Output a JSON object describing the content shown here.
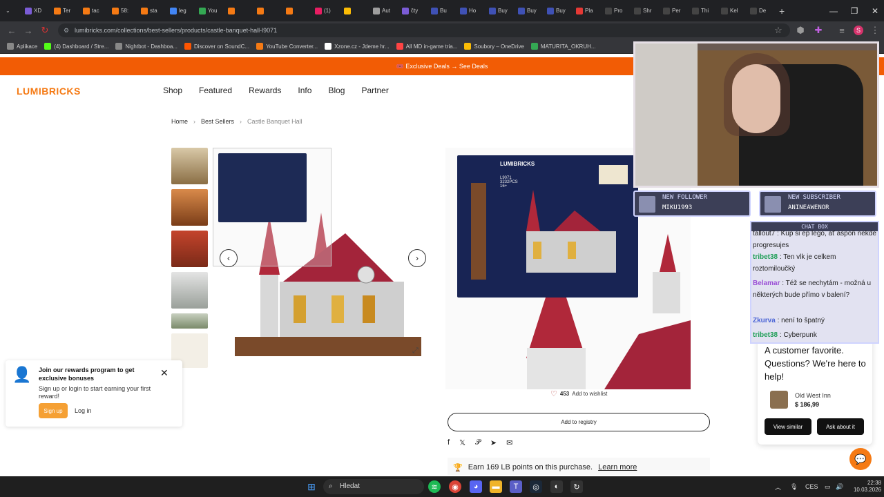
{
  "browser": {
    "tabs": [
      {
        "label": "XD",
        "color": "#7b5cd6"
      },
      {
        "label": "Ter",
        "color": "#f57a14"
      },
      {
        "label": "tac",
        "color": "#f57a14"
      },
      {
        "label": "58:",
        "color": "#f57a14"
      },
      {
        "label": "sta",
        "color": "#f57a14"
      },
      {
        "label": "leg",
        "color": "#4285f4"
      },
      {
        "label": "You",
        "color": "#34a853"
      },
      {
        "label": "",
        "color": "#f57a14"
      },
      {
        "label": "",
        "color": "#f57a14"
      },
      {
        "label": "",
        "color": "#f57a14"
      },
      {
        "label": "(1)",
        "color": "#e91e63"
      },
      {
        "label": "",
        "color": "#fbbc05"
      },
      {
        "label": "Aut",
        "color": "#9e9e9e"
      },
      {
        "label": "čty",
        "color": "#7b5cd6"
      },
      {
        "label": "Bu",
        "color": "#3f51b5"
      },
      {
        "label": "Ho",
        "color": "#3f51b5"
      },
      {
        "label": "Buy",
        "color": "#3f51b5"
      },
      {
        "label": "Buy",
        "color": "#3f51b5"
      },
      {
        "label": "Buy",
        "color": "#3f51b5"
      },
      {
        "label": "Pla",
        "color": "#e53935"
      },
      {
        "label": "Pro",
        "color": "#444"
      },
      {
        "label": "Shr",
        "color": "#444"
      },
      {
        "label": "Per",
        "color": "#444"
      },
      {
        "label": "Thi",
        "color": "#444"
      },
      {
        "label": "Kel",
        "color": "#444"
      },
      {
        "label": "De",
        "color": "#444"
      }
    ],
    "url": "lumibricks.com/collections/best-sellers/products/castle-banquet-hall-l9071",
    "bookmarks": [
      {
        "label": "Aplikace",
        "color": "#888"
      },
      {
        "label": "(4) Dashboard / Stre...",
        "color": "#53fc18"
      },
      {
        "label": "Nightbot - Dashboa...",
        "color": "#888"
      },
      {
        "label": "Discover on SoundC...",
        "color": "#f50"
      },
      {
        "label": "YouTube Converter...",
        "color": "#f57a14"
      },
      {
        "label": "Xzone.cz - Jdeme hr...",
        "color": "#fff"
      },
      {
        "label": "All MD in-game tria...",
        "color": "#f44"
      },
      {
        "label": "Soubory – OneDrive",
        "color": "#fbbc05"
      },
      {
        "label": "MATURITA_OKRUH...",
        "color": "#34a853"
      }
    ]
  },
  "site": {
    "promo": "🎟️ Exclusive Deals → See Deals",
    "logo": "LUMIBRICKS",
    "nav": [
      "Shop",
      "Featured",
      "Rewards",
      "Info",
      "Blog",
      "Partner"
    ],
    "breadcrumb": {
      "home": "Home",
      "section": "Best Sellers",
      "current": "Castle Banquet Hall",
      "sep": "›"
    },
    "box": {
      "brand": "LUMIBRICKS",
      "model": "L9071",
      "pcs": "3232PCS",
      "age": "16+"
    },
    "wishlist": {
      "count": "453",
      "label": "Add to wishlist"
    },
    "registry": "Add to registry",
    "points": {
      "text": "Earn 169 LB points on this purchase.",
      "link": "Learn more"
    },
    "reward_popup": {
      "title": "Join our rewards program to get exclusive bonuses",
      "body": "Sign up or login to start earning your first reward!",
      "signup": "Sign up",
      "login": "Log in"
    },
    "help": {
      "title": "A customer favorite. Questions? We're here to help!",
      "product_name": "Old West Inn",
      "product_price": "$ 186,99",
      "view_similar": "View similar",
      "ask": "Ask about it"
    }
  },
  "overlay": {
    "follower_label": "NEW FOLLOWER",
    "follower_name": "MIKU1993",
    "subscriber_label": "NEW SUBSCRIBER",
    "subscriber_name": "ANINEAWENOR",
    "chat_title": "CHAT BOX",
    "messages": [
      {
        "user": "",
        "text": "tallout7 : Kup si ep lego, ať aspoň nekde progresujes",
        "color": "#4b9e3a"
      },
      {
        "user": "tribet38",
        "text": " : Ten vlk je celkem roztomiloučký",
        "color": "#1e9e56"
      },
      {
        "user": "Belamar",
        "text": " : Též se nechytám - možná u některých bude přímo v balení?",
        "color": "#9b4fd6"
      },
      {
        "user": "Zkurva",
        "text": " : není to špatný",
        "color": "#4a64d6"
      },
      {
        "user": "tribet38",
        "text": " : Cyberpunk",
        "color": "#1e9e56"
      }
    ]
  },
  "taskbar": {
    "search": "Hledat",
    "lang": "CES",
    "time": "22:38",
    "date": "10.03.2026"
  },
  "colors": {
    "accent": "#f57a14",
    "promo": "#f25c05"
  }
}
